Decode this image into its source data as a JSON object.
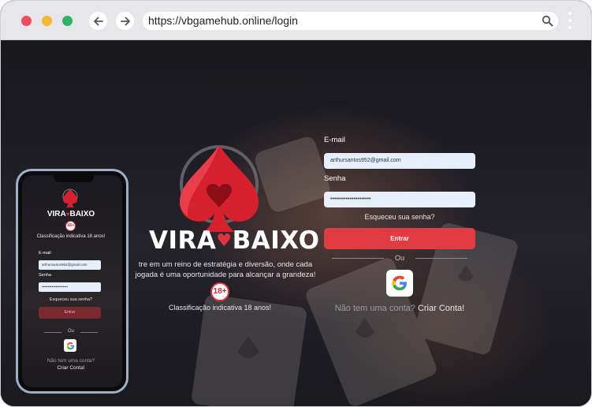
{
  "browser": {
    "url": "https://vbgamehub.online/login",
    "icons": {
      "back": "arrow-left-icon",
      "forward": "arrow-right-icon",
      "search": "search-icon",
      "menu": "kebab-menu-icon"
    }
  },
  "colors": {
    "accent": "#e33b44",
    "background": "#1c1b22",
    "field": "#e8effc"
  },
  "hero": {
    "brand_left": "VIRA",
    "brand_heart": "♥",
    "brand_right": "BAIXO",
    "tagline": "tre em um reino de estratégia e diversão, onde cada jogada é uma oportunidade para alcançar a grandeza!",
    "age_badge": "18+",
    "rating": "Classificação indicativa 18 anos!"
  },
  "login": {
    "email_label": "E-mail",
    "email_value": "arthursantos952@gmail.com",
    "password_label": "Senha",
    "password_value": "•••••••••••••••••••••",
    "forgot": "Esqueceu sua senha?",
    "submit": "Entrar",
    "or": "Ou",
    "google_icon": "google-icon",
    "no_account": "Não tem uma conta?",
    "create_account": "Criar Conta!"
  },
  "mobile": {
    "brand_left": "VIRA",
    "brand_heart": "♥",
    "brand_right": "BAIXO",
    "age_badge": "18+",
    "rating": "Classificação indicativa 18 anos!",
    "email_label": "E-mail",
    "email_value": "arthursantos952@gmail.com",
    "password_label": "Senha",
    "password_value": "•••••••••••••••••••••",
    "forgot": "Esqueceu sua senha?",
    "submit": "Entrar",
    "or": "Ou",
    "no_account": "Não tem uma conta?",
    "create_account": "Criar Conta!"
  }
}
